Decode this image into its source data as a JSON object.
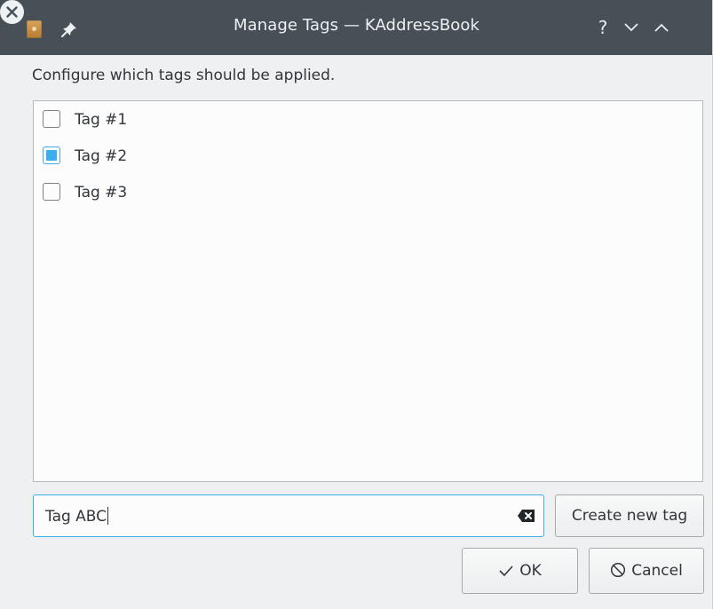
{
  "window": {
    "title": "Manage Tags — KAddressBook",
    "controls": {
      "help": "?",
      "minimize_icon": "chevron-down-icon",
      "maximize_icon": "chevron-up-icon",
      "close_icon": "close-icon"
    },
    "app_icon": "addressbook-icon",
    "pin_icon": "pin-icon"
  },
  "dialog": {
    "description": "Configure which tags should be applied.",
    "tags": [
      {
        "label": "Tag #1",
        "checked": false
      },
      {
        "label": "Tag #2",
        "checked": true
      },
      {
        "label": "Tag #3",
        "checked": false
      }
    ],
    "new_tag_input": {
      "value": "Tag ABC",
      "clear_icon": "clear-text-icon"
    },
    "create_button": "Create new tag",
    "ok_button": "OK",
    "cancel_button": "Cancel"
  },
  "colors": {
    "titlebar": "#475057",
    "accent": "#3daee9",
    "background": "#eff0f1"
  }
}
